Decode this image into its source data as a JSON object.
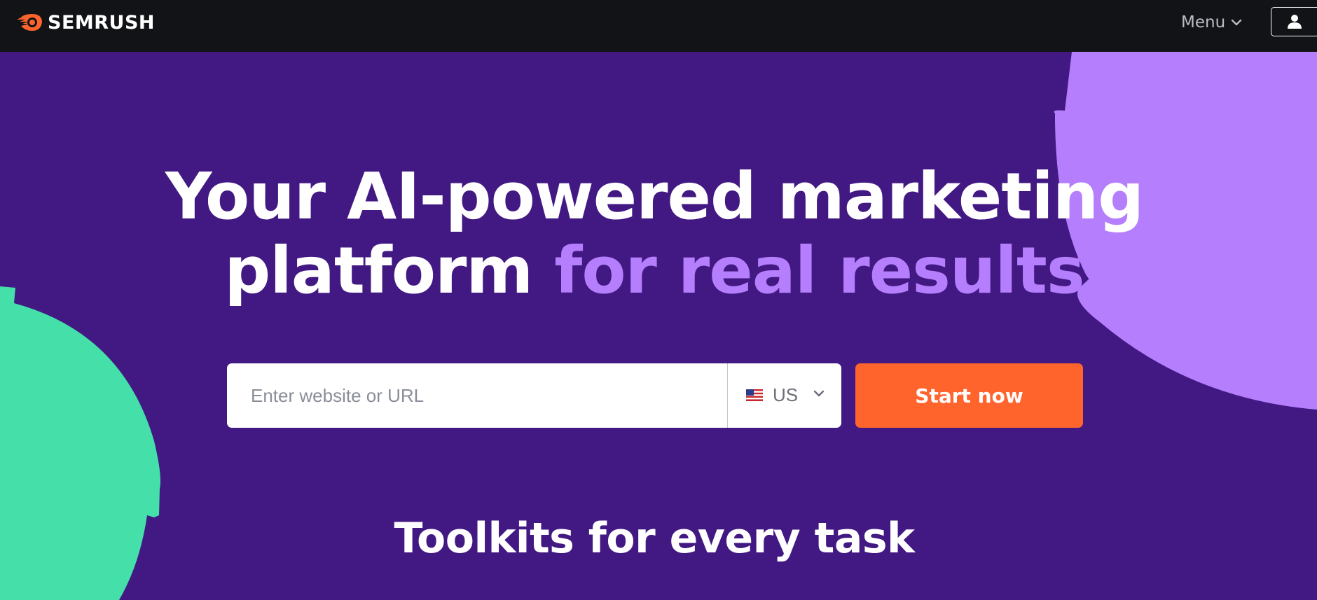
{
  "nav": {
    "logo_text": "SEMRUSH",
    "menu_label": "Menu",
    "menu_icon": "chevron-down-icon",
    "account_icon": "user-icon"
  },
  "hero": {
    "title_line1": "Your AI-powered marketing",
    "title_line2_main": "platform",
    "title_line2_accent": "for real results"
  },
  "search": {
    "placeholder": "Enter website or URL",
    "value": "",
    "region_selected": "US",
    "region_flag_icon": "us-flag-icon",
    "start_label": "Start now"
  },
  "sections": {
    "toolkits_title": "Toolkits for every task"
  },
  "colors": {
    "nav_bg": "#121316",
    "hero_bg": "#421983",
    "accent_purple": "#b57efc",
    "blob_green": "#45e0a9",
    "blob_purple": "#b57efc",
    "cta_orange": "#ff642d",
    "logo_orange": "#ff642d"
  }
}
